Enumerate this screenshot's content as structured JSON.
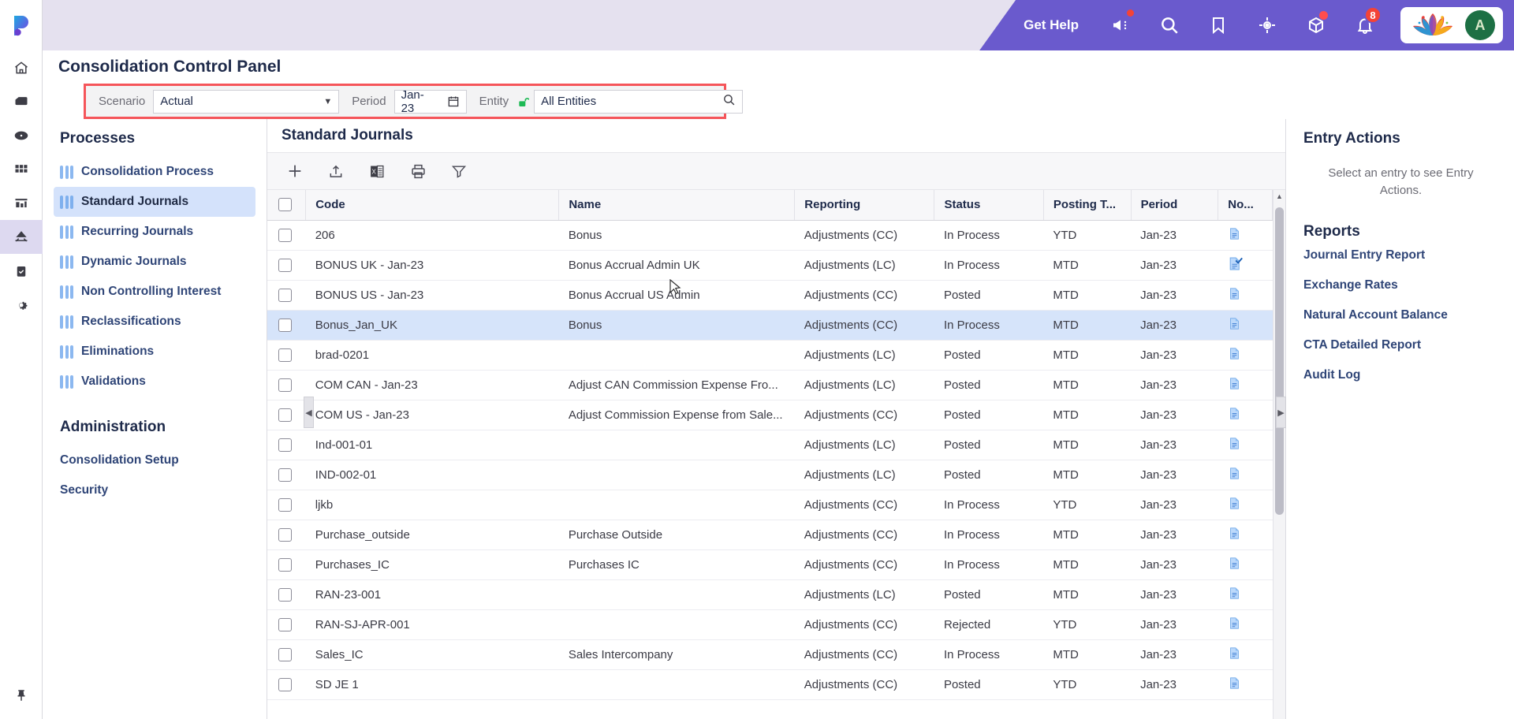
{
  "topbar": {
    "get_help": "Get Help",
    "notification_count": "8",
    "avatar_initial": "A",
    "icons": [
      "megaphone-icon",
      "search-icon",
      "bookmark-icon",
      "target-icon",
      "cube-icon",
      "bell-icon"
    ],
    "accent_purple": "#6a5acd",
    "band_lilac": "#e5e1ef",
    "badge_red": "#f44336"
  },
  "rail": {
    "logo": "planful-logo",
    "items": [
      {
        "name": "home-icon"
      },
      {
        "name": "package-icon"
      },
      {
        "name": "eye-icon"
      },
      {
        "name": "grid-icon"
      },
      {
        "name": "chart-icon"
      },
      {
        "name": "consolidation-icon",
        "active": true
      },
      {
        "name": "clipboard-check-icon"
      },
      {
        "name": "gear-icon"
      }
    ],
    "pin": "pin-icon"
  },
  "page": {
    "title": "Consolidation Control Panel",
    "highlight_color": "#f5555a"
  },
  "filters": {
    "scenario": {
      "label": "Scenario",
      "value": "Actual"
    },
    "period": {
      "label": "Period",
      "value": "Jan-23"
    },
    "entity": {
      "label": "Entity",
      "value": "All Entities",
      "lock": "unlocked-lock-icon"
    }
  },
  "nav": {
    "processes_heading": "Processes",
    "processes": [
      {
        "label": "Consolidation Process",
        "active": false
      },
      {
        "label": "Standard Journals",
        "active": true
      },
      {
        "label": "Recurring Journals",
        "active": false
      },
      {
        "label": "Dynamic Journals",
        "active": false
      },
      {
        "label": "Non Controlling Interest",
        "active": false
      },
      {
        "label": "Reclassifications",
        "active": false
      },
      {
        "label": "Eliminations",
        "active": false
      },
      {
        "label": "Validations",
        "active": false
      }
    ],
    "admin_heading": "Administration",
    "admin": [
      {
        "label": "Consolidation Setup"
      },
      {
        "label": "Security"
      }
    ]
  },
  "content": {
    "title": "Standard Journals",
    "toolbar": [
      {
        "name": "add-icon",
        "label": "Add"
      },
      {
        "name": "upload-icon",
        "label": "Upload"
      },
      {
        "name": "excel-export-icon",
        "label": "Export to Excel"
      },
      {
        "name": "print-icon",
        "label": "Print"
      },
      {
        "name": "filter-icon",
        "label": "Filter"
      }
    ],
    "columns": [
      "Code",
      "Name",
      "Reporting",
      "Status",
      "Posting T...",
      "Period",
      "No..."
    ],
    "rows": [
      {
        "code": "206",
        "name": "Bonus",
        "reporting": "Adjustments (CC)",
        "status": "In Process",
        "posting": "YTD",
        "period": "Jan-23",
        "note": "document-icon",
        "selected": false
      },
      {
        "code": "BONUS UK - Jan-23",
        "name": "Bonus Accrual Admin UK",
        "reporting": "Adjustments (LC)",
        "status": "In Process",
        "posting": "MTD",
        "period": "Jan-23",
        "note": "document-check-icon",
        "selected": false
      },
      {
        "code": "BONUS US - Jan-23",
        "name": "Bonus Accrual US Admin",
        "reporting": "Adjustments (CC)",
        "status": "Posted",
        "posting": "MTD",
        "period": "Jan-23",
        "note": "document-icon",
        "selected": false
      },
      {
        "code": "Bonus_Jan_UK",
        "name": "Bonus",
        "reporting": "Adjustments (CC)",
        "status": "In Process",
        "posting": "MTD",
        "period": "Jan-23",
        "note": "document-icon",
        "selected": true
      },
      {
        "code": "brad-0201",
        "name": "",
        "reporting": "Adjustments (LC)",
        "status": "Posted",
        "posting": "MTD",
        "period": "Jan-23",
        "note": "document-icon",
        "selected": false
      },
      {
        "code": "COM CAN - Jan-23",
        "name": "Adjust CAN Commission Expense Fro...",
        "reporting": "Adjustments (LC)",
        "status": "Posted",
        "posting": "MTD",
        "period": "Jan-23",
        "note": "document-icon",
        "selected": false
      },
      {
        "code": "COM US - Jan-23",
        "name": "Adjust Commission Expense from Sale...",
        "reporting": "Adjustments (CC)",
        "status": "Posted",
        "posting": "MTD",
        "period": "Jan-23",
        "note": "document-icon",
        "selected": false
      },
      {
        "code": "Ind-001-01",
        "name": "",
        "reporting": "Adjustments (LC)",
        "status": "Posted",
        "posting": "MTD",
        "period": "Jan-23",
        "note": "document-icon",
        "selected": false
      },
      {
        "code": "IND-002-01",
        "name": "",
        "reporting": "Adjustments (LC)",
        "status": "Posted",
        "posting": "MTD",
        "period": "Jan-23",
        "note": "document-icon",
        "selected": false
      },
      {
        "code": "ljkb",
        "name": "",
        "reporting": "Adjustments (CC)",
        "status": "In Process",
        "posting": "YTD",
        "period": "Jan-23",
        "note": "document-icon",
        "selected": false
      },
      {
        "code": "Purchase_outside",
        "name": "Purchase Outside",
        "reporting": "Adjustments (CC)",
        "status": "In Process",
        "posting": "MTD",
        "period": "Jan-23",
        "note": "document-icon",
        "selected": false
      },
      {
        "code": "Purchases_IC",
        "name": "Purchases IC",
        "reporting": "Adjustments (CC)",
        "status": "In Process",
        "posting": "MTD",
        "period": "Jan-23",
        "note": "document-icon",
        "selected": false
      },
      {
        "code": "RAN-23-001",
        "name": "",
        "reporting": "Adjustments (LC)",
        "status": "Posted",
        "posting": "MTD",
        "period": "Jan-23",
        "note": "document-icon",
        "selected": false
      },
      {
        "code": "RAN-SJ-APR-001",
        "name": "",
        "reporting": "Adjustments (CC)",
        "status": "Rejected",
        "posting": "YTD",
        "period": "Jan-23",
        "note": "document-icon",
        "selected": false
      },
      {
        "code": "Sales_IC",
        "name": "Sales Intercompany",
        "reporting": "Adjustments (CC)",
        "status": "In Process",
        "posting": "MTD",
        "period": "Jan-23",
        "note": "document-icon",
        "selected": false
      },
      {
        "code": "SD JE 1",
        "name": "",
        "reporting": "Adjustments (CC)",
        "status": "Posted",
        "posting": "YTD",
        "period": "Jan-23",
        "note": "document-icon",
        "selected": false
      }
    ]
  },
  "right": {
    "entry_actions_heading": "Entry Actions",
    "entry_actions_note": "Select an entry to see Entry Actions.",
    "reports_heading": "Reports",
    "reports": [
      {
        "label": "Journal Entry Report"
      },
      {
        "label": "Exchange Rates"
      },
      {
        "label": "Natural Account Balance"
      },
      {
        "label": "CTA Detailed Report"
      },
      {
        "label": "Audit Log"
      }
    ]
  }
}
